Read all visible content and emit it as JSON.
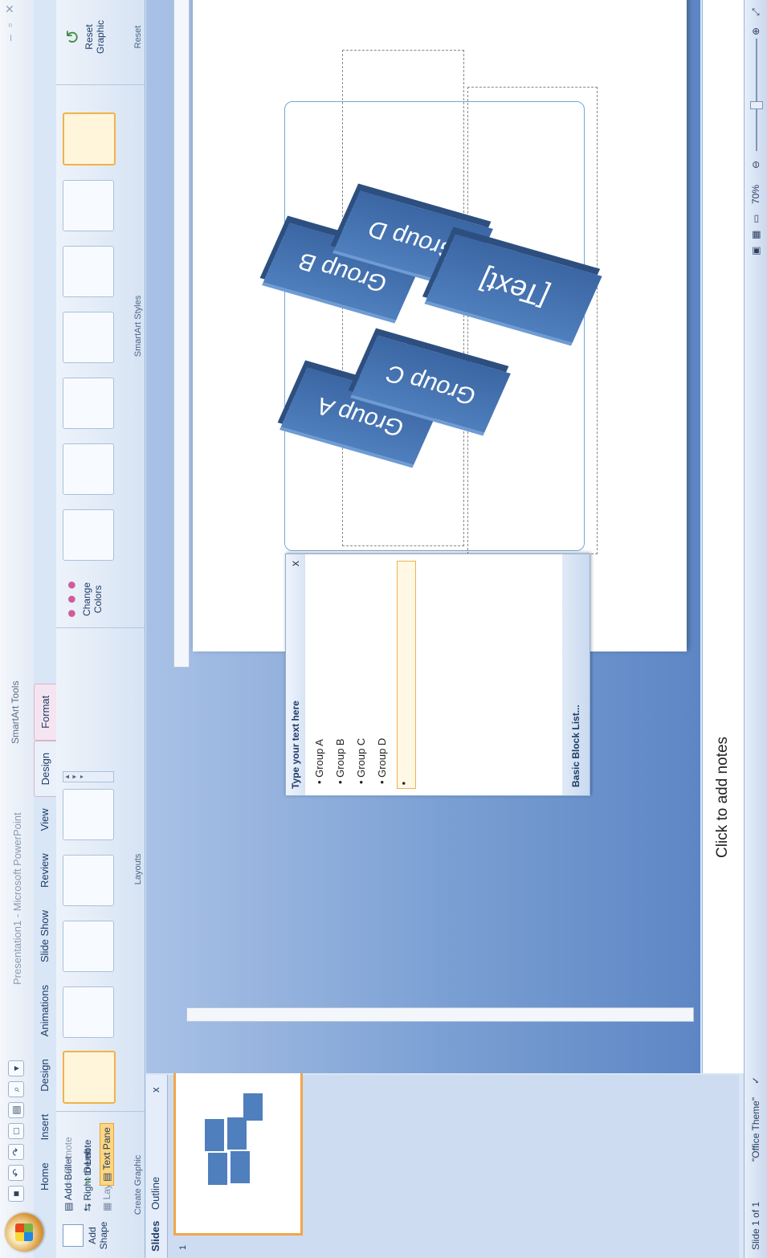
{
  "window": {
    "title": "Presentation1 - Microsoft PowerPoint",
    "context_tools": "SmartArt Tools"
  },
  "tabs": [
    "Home",
    "Insert",
    "Design",
    "Animations",
    "Slide Show",
    "Review",
    "View",
    "Design",
    "Format"
  ],
  "ribbon": {
    "create_graphic": {
      "add_shape": "Add Shape",
      "add_bullet": "Add Bullet",
      "right_to_left": "Right to Left",
      "layout": "Layout",
      "promote": "Promote",
      "demote": "Demote",
      "text_pane": "Text Pane",
      "label": "Create Graphic"
    },
    "layouts": {
      "label": "Layouts"
    },
    "change_colors": "Change Colors",
    "smartart_styles": {
      "label": "SmartArt Styles"
    },
    "reset": {
      "reset_graphic": "Reset Graphic",
      "label": "Reset"
    }
  },
  "left_pane": {
    "tabs": [
      "Slides",
      "Outline"
    ],
    "close": "x",
    "slide_number": "1"
  },
  "text_pane": {
    "title": "Type your text here",
    "close": "x",
    "items": [
      "Group A",
      "Group B",
      "Group C",
      "Group D",
      ""
    ],
    "footer": "Basic Block List..."
  },
  "slide": {
    "blocks": [
      "Group A",
      "Group B",
      "Group C",
      "Group D",
      "[Text]"
    ]
  },
  "notes": {
    "placeholder": "Click to add notes"
  },
  "status": {
    "slide": "Slide 1 of 1",
    "theme": "\"Office Theme\"",
    "zoom": "70%",
    "zoom_level": 70
  },
  "colors": {
    "accent": "#4f81bd",
    "selection": "#f1b24b"
  }
}
